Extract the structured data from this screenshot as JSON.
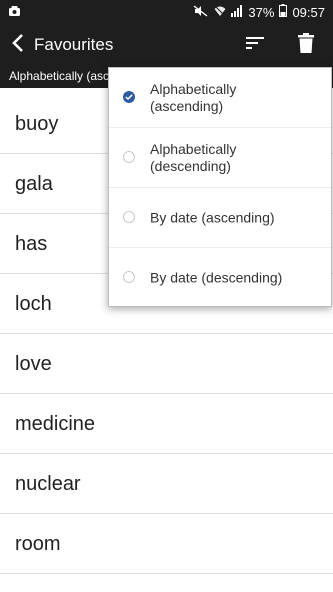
{
  "status_bar": {
    "battery": "37%",
    "time": "09:57"
  },
  "app_bar": {
    "title": "Favourites"
  },
  "sub_bar": {
    "text": "Alphabetically (ascending)"
  },
  "words": [
    "buoy",
    "gala",
    "has",
    "loch",
    "love",
    "medicine",
    "nuclear",
    "room"
  ],
  "sort_menu": {
    "selected_index": 0,
    "options": [
      {
        "label": "Alphabetically\n(ascending)",
        "selected": true
      },
      {
        "label": "Alphabetically\n(descending)",
        "selected": false
      },
      {
        "label": "By date (ascending)",
        "selected": false
      },
      {
        "label": "By date (descending)",
        "selected": false
      }
    ]
  },
  "colors": {
    "bar_background": "#1e1e1e",
    "accent": "#2d5aa0"
  }
}
